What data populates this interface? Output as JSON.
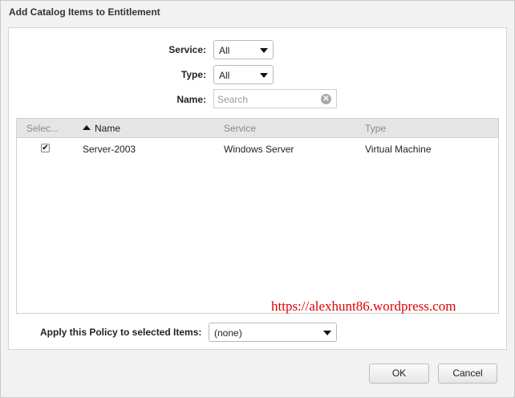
{
  "dialog": {
    "title": "Add Catalog Items to Entitlement"
  },
  "filters": {
    "service_label": "Service:",
    "service_value": "All",
    "type_label": "Type:",
    "type_value": "All",
    "name_label": "Name:",
    "name_placeholder": "Search"
  },
  "grid": {
    "columns": [
      "Selec...",
      "Name",
      "Service",
      "Type"
    ],
    "sort_column": "Name",
    "sort_direction": "ascending",
    "rows": [
      {
        "selected": true,
        "name": "Server-2003",
        "service": "Windows Server",
        "type": "Virtual Machine"
      }
    ]
  },
  "watermark": "https://alexhunt86.wordpress.com",
  "policy": {
    "label": "Apply this Policy to selected Items:",
    "value": "(none)"
  },
  "footer": {
    "ok_label": "OK",
    "cancel_label": "Cancel"
  },
  "icons": {
    "dropdown": "chevron-down-icon",
    "clear": "clear-search-icon",
    "sort": "sort-ascending-icon",
    "check": "checkmark-icon"
  }
}
